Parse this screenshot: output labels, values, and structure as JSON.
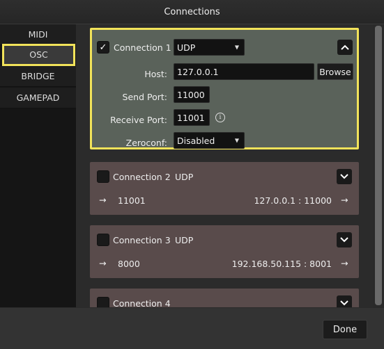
{
  "window": {
    "title": "Connections"
  },
  "sidebar": {
    "items": [
      {
        "label": "MIDI"
      },
      {
        "label": "OSC"
      },
      {
        "label": "BRIDGE"
      },
      {
        "label": "GAMEPAD"
      }
    ]
  },
  "connections": [
    {
      "name": "Connection 1",
      "checked": true,
      "check_glyph": "✓",
      "protocol": "UDP",
      "host_label": "Host:",
      "host": "127.0.0.1",
      "browse_label": "Browse",
      "send_port_label": "Send Port:",
      "send_port": "11000",
      "receive_port_label": "Receive Port:",
      "receive_port": "11001",
      "info_glyph": "i",
      "zeroconf_label": "Zeroconf:",
      "zeroconf": "Disabled"
    },
    {
      "name": "Connection 2",
      "checked": false,
      "protocol": "UDP",
      "arrow": "→",
      "in_port": "11001",
      "target": "127.0.0.1 : 11000"
    },
    {
      "name": "Connection 3",
      "checked": false,
      "protocol": "UDP",
      "arrow": "→",
      "in_port": "8000",
      "target": "192.168.50.115 : 8001"
    },
    {
      "name": "Connection 4",
      "checked": false
    }
  ],
  "footer": {
    "done_label": "Done"
  },
  "colors": {
    "highlight": "#f2e35a",
    "active_panel": "#5a625a",
    "inactive_panel": "#594b4b"
  }
}
